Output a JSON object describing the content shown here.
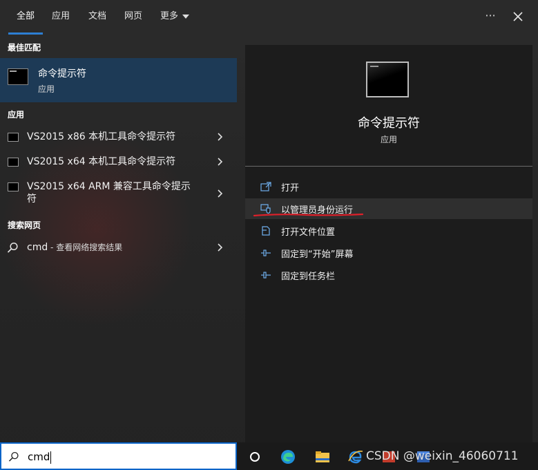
{
  "tabs": [
    {
      "label": "全部"
    },
    {
      "label": "应用"
    },
    {
      "label": "文档"
    },
    {
      "label": "网页"
    },
    {
      "label": "更多"
    }
  ],
  "top_actions": {
    "more": "···"
  },
  "sections": {
    "best_match": "最佳匹配",
    "apps": "应用",
    "web": "搜索网页"
  },
  "best_match": {
    "title": "命令提示符",
    "subtitle": "应用"
  },
  "apps": [
    {
      "label": "VS2015 x86 本机工具命令提示符"
    },
    {
      "label": "VS2015 x64 本机工具命令提示符"
    },
    {
      "label": "VS2015 x64 ARM 兼容工具命令提示符"
    }
  ],
  "web_search": {
    "query": "cmd",
    "hint": " - 查看网络搜索结果"
  },
  "preview": {
    "title": "命令提示符",
    "subtitle": "应用"
  },
  "actions": [
    {
      "label": "打开",
      "icon": "open-icon"
    },
    {
      "label": "以管理员身份运行",
      "icon": "shield-icon"
    },
    {
      "label": "打开文件位置",
      "icon": "folder-icon"
    },
    {
      "label": "固定到“开始”屏幕",
      "icon": "pin-icon"
    },
    {
      "label": "固定到任务栏",
      "icon": "pin-icon"
    }
  ],
  "search_box": {
    "value": "cmd"
  },
  "watermark": "CSDN @weixin_46060711",
  "colors": {
    "accent": "#2d7fd3",
    "selected_bg": "#1d3a56",
    "annotation": "#e0202a"
  }
}
